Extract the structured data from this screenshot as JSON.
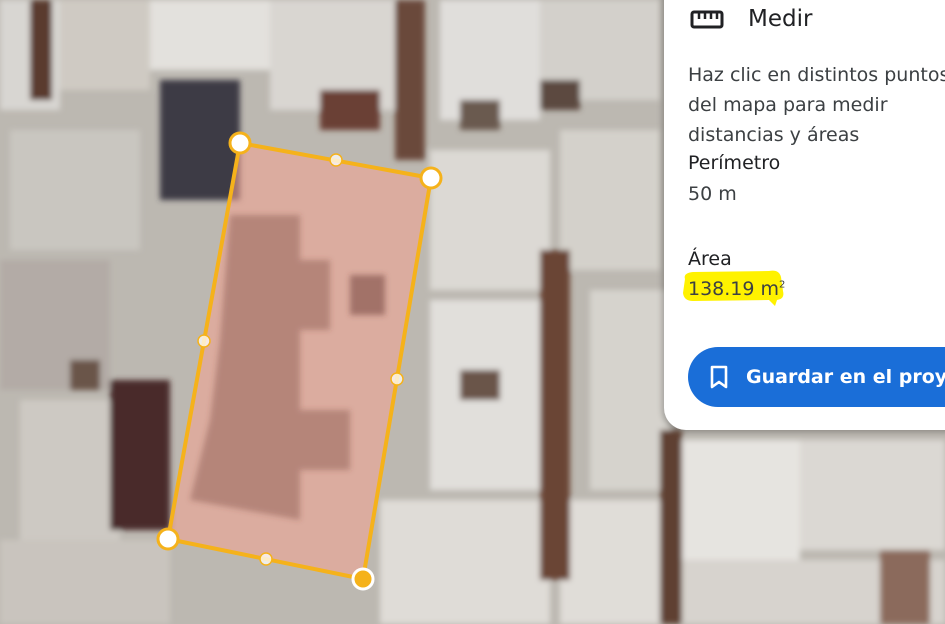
{
  "panel": {
    "title": "Medir",
    "title_icon": "ruler-icon",
    "description": "Haz clic en distintos puntos del mapa para medir distancias y áreas",
    "perimeter_label": "Perímetro",
    "perimeter_value": "50 m",
    "area_label": "Área",
    "area_value": "138.19 m",
    "area_unit_superscript": "2",
    "save_button_label": "Guardar en el proyecto",
    "save_button_icon": "bookmark-icon",
    "accent_color": "#1a6ed8",
    "highlight_color": "#fff200"
  },
  "measurement": {
    "polygon_color": "#f5b21b",
    "fill_color": "#f4a38f"
  }
}
